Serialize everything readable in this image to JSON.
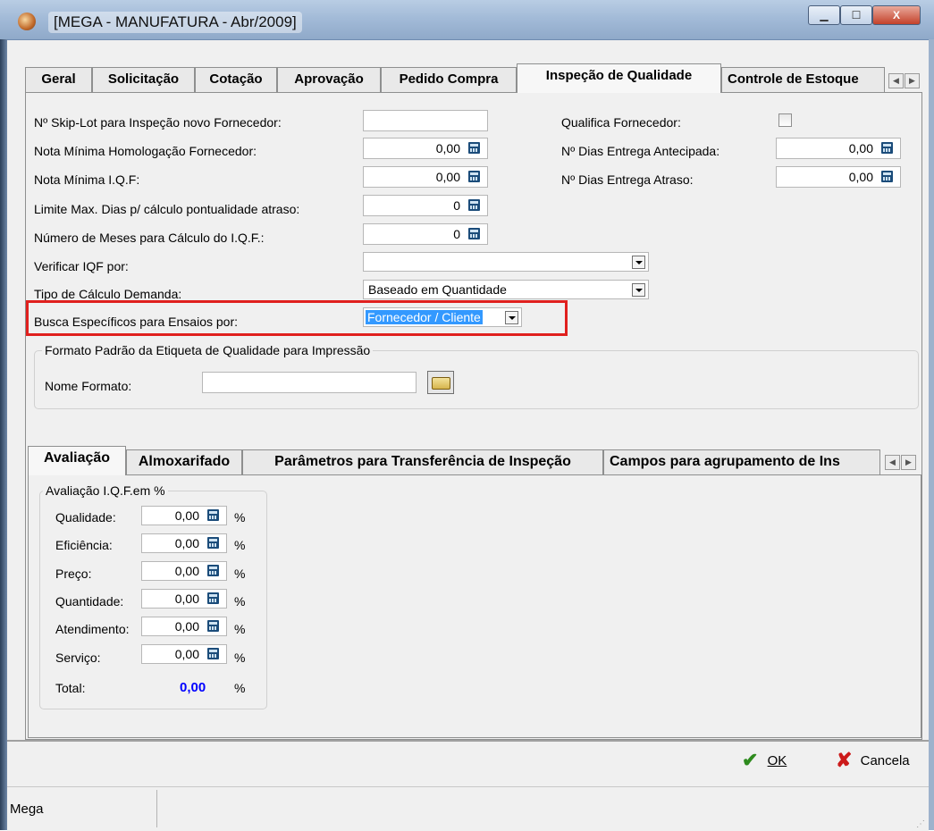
{
  "window": {
    "title": "[MEGA - MANUFATURA - Abr/2009]",
    "controls": [
      "minimize",
      "maximize",
      "close"
    ]
  },
  "top_tabs": [
    {
      "label": "Geral",
      "underline": "G"
    },
    {
      "label": "Solicitação",
      "underline": "S"
    },
    {
      "label": "Cotação",
      "underline": "C"
    },
    {
      "label": "Aprovação",
      "underline": "A"
    },
    {
      "label": "Pedido Compra",
      "underline": "P"
    },
    {
      "label": "Inspeção de Qualidade",
      "underline": "Q",
      "active": true
    },
    {
      "label": "Controle de Estoque",
      "underline": "E"
    }
  ],
  "form": {
    "skip_lot_label": "Nº Skip-Lot para Inspeção novo Fornecedor:",
    "skip_lot_value": "",
    "nota_homologacao_label": "Nota Mínima Homologação Fornecedor:",
    "nota_homologacao_value": "0,00",
    "nota_iqf_label": "Nota Mínima I.Q.F:",
    "nota_iqf_value": "0,00",
    "limite_dias_label": "Limite Max. Dias p/ cálculo pontualidade atraso:",
    "limite_dias_value": "0",
    "numero_meses_label": "Número de Meses para Cálculo do I.Q.F.:",
    "numero_meses_value": "0",
    "qualifica_label": "Qualifica Fornecedor:",
    "qualifica_checked": false,
    "dias_antecipada_label": "Nº Dias Entrega Antecipada:",
    "dias_antecipada_value": "0,00",
    "dias_atraso_label": "Nº Dias Entrega Atraso:",
    "dias_atraso_value": "0,00",
    "verificar_iqf_label": "Verificar IQF por:",
    "verificar_iqf_value": "",
    "tipo_calculo_label": "Tipo de Cálculo Demanda:",
    "tipo_calculo_value": "Baseado em Quantidade",
    "busca_especificos_label": "Busca Específicos para Ensaios por:",
    "busca_especificos_value": "Fornecedor / Cliente"
  },
  "etiqueta_group": {
    "title": "Formato Padrão da Etiqueta de Qualidade para Impressão",
    "nome_formato_label": "Nome Formato:",
    "nome_formato_value": ""
  },
  "bottom_tabs": [
    {
      "label": "Avaliação",
      "active": true
    },
    {
      "label": "Almoxarifado"
    },
    {
      "label": "Parâmetros para Transferência de Inspeção"
    },
    {
      "label": "Campos para agrupamento de Ins"
    }
  ],
  "avaliacao": {
    "group_title": "Avaliação I.Q.F.em %",
    "rows": [
      {
        "label": "Qualidade:",
        "value": "0,00",
        "unit": "%"
      },
      {
        "label": "Eficiência:",
        "value": "0,00",
        "unit": "%"
      },
      {
        "label": "Preço:",
        "value": "0,00",
        "unit": "%"
      },
      {
        "label": "Quantidade:",
        "value": "0,00",
        "unit": "%"
      },
      {
        "label": "Atendimento:",
        "value": "0,00",
        "unit": "%"
      },
      {
        "label": "Serviço:",
        "value": "0,00",
        "unit": "%"
      }
    ],
    "total_label": "Total:",
    "total_value": "0,00",
    "total_unit": "%",
    "total_color": "#0000ff"
  },
  "actions": {
    "ok_label": "OK",
    "ok_underline": "O",
    "cancel_label": "Cancela",
    "cancel_underline": "C",
    "ok_icon_color": "#2e8b1e",
    "cancel_icon_color": "#cc1a1a"
  },
  "status": {
    "text": "Mega"
  },
  "colors": {
    "highlight_border": "#e0201e",
    "selection_bg": "#3399ff"
  }
}
